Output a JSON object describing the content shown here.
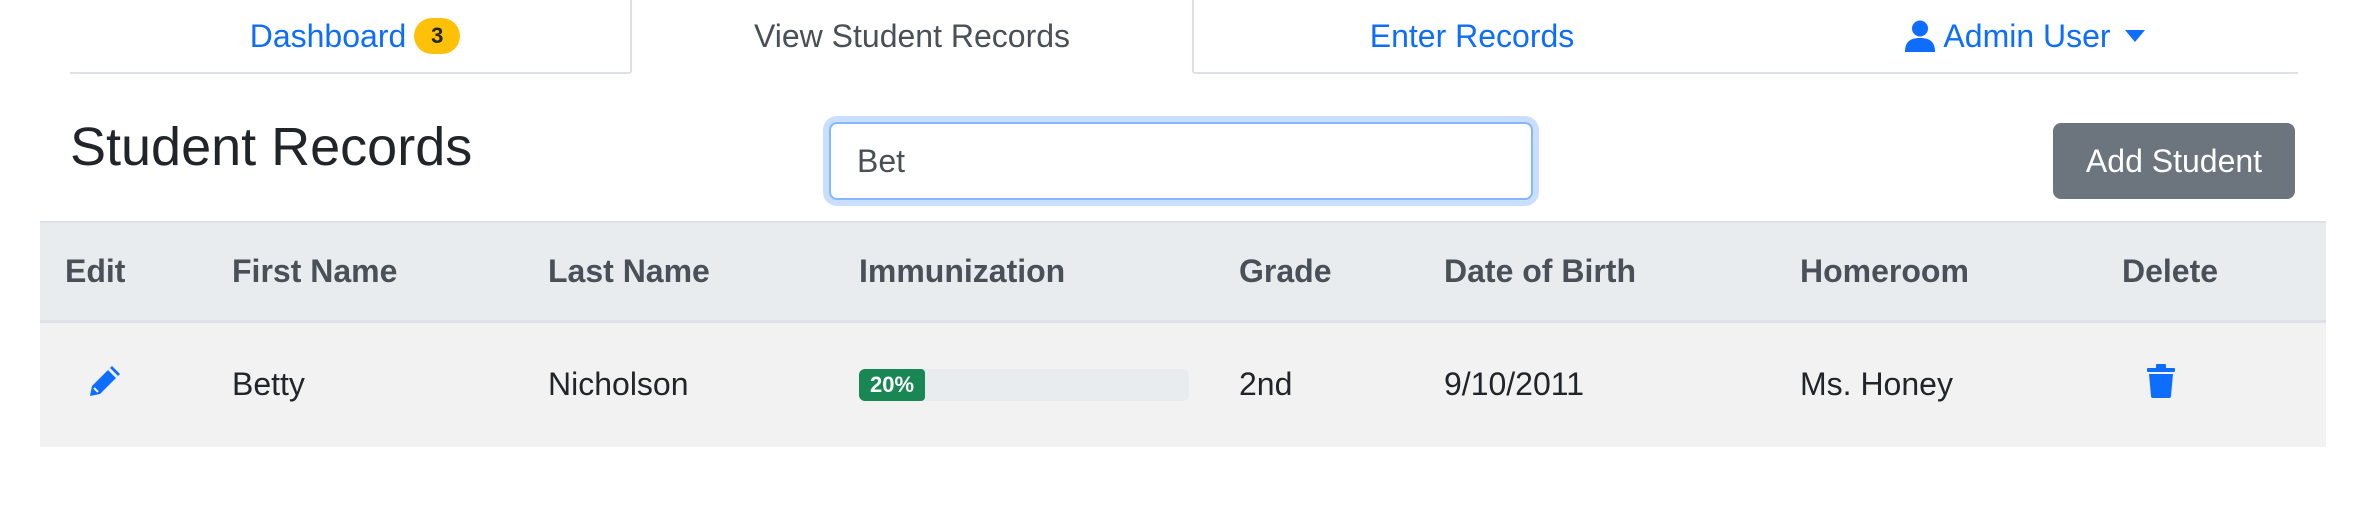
{
  "nav": {
    "dashboard_label": "Dashboard",
    "dashboard_badge": "3",
    "view_records_label": "View Student Records",
    "enter_records_label": "Enter Records",
    "user_label": "Admin User",
    "icons": {
      "user": "user-icon",
      "caret": "caret-down-icon"
    }
  },
  "header": {
    "title": "Student Records",
    "search_value": "Bet",
    "add_button_label": "Add Student"
  },
  "table": {
    "columns": [
      "Edit",
      "First Name",
      "Last Name",
      "Immunization",
      "Grade",
      "Date of Birth",
      "Homeroom",
      "Delete"
    ],
    "rows": [
      {
        "first_name": "Betty",
        "last_name": "Nicholson",
        "immunization_label": "20%",
        "immunization_fraction": 0.2,
        "grade": "2nd",
        "dob": "9/10/2011",
        "homeroom": "Ms. Honey"
      }
    ]
  },
  "colors": {
    "link": "#0d6efd",
    "badge": "#ffc107",
    "success": "#198754",
    "secondary_button": "#6c757d",
    "header_bg": "#e9ecef",
    "row_bg": "#f2f2f2"
  }
}
